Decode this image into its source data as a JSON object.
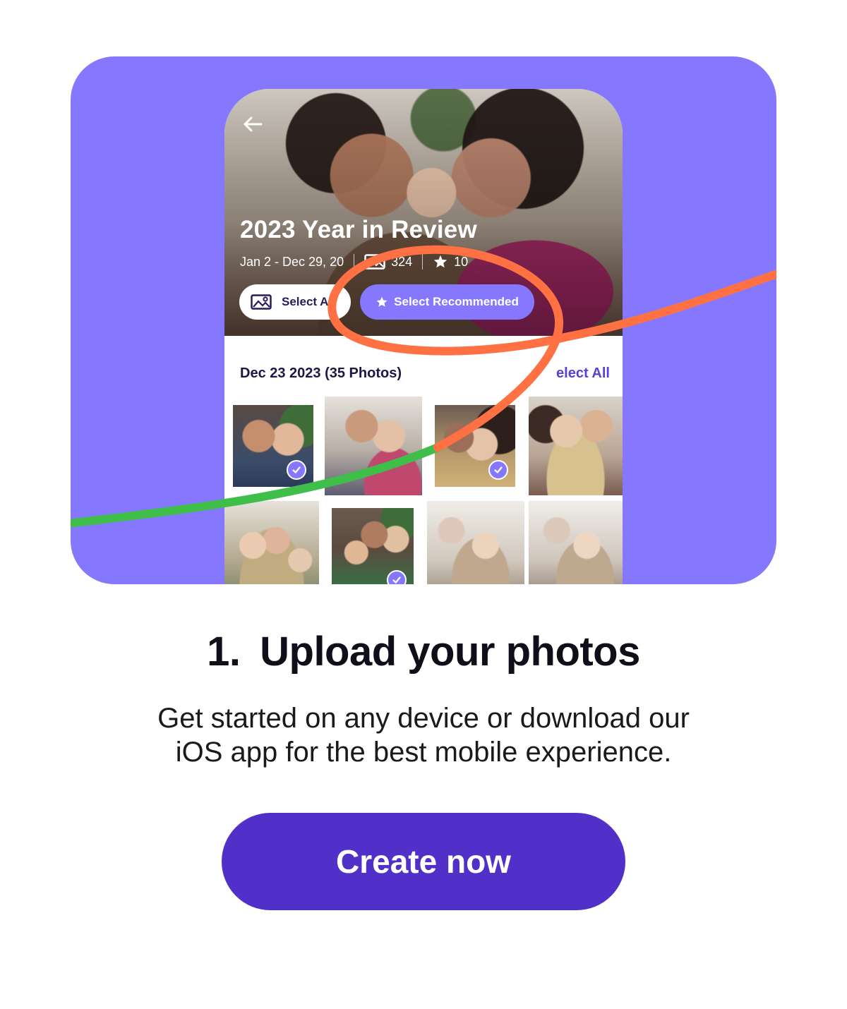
{
  "album": {
    "title": "2023 Year in Review",
    "date_range": "Jan 2 - Dec 29, 20",
    "photo_count": "324",
    "star_count": "10",
    "select_all_label": "Select A",
    "select_recommended_label": "Select Recommended"
  },
  "section": {
    "date_label": "Dec 23 2023 (35 Photos)",
    "select_all_label": "elect All"
  },
  "thumbnails": [
    {
      "selected": true
    },
    {
      "selected": false
    },
    {
      "selected": true
    },
    {
      "selected": false
    },
    {
      "selected": false
    },
    {
      "selected": true
    },
    {
      "selected": false
    },
    {
      "selected": false
    }
  ],
  "step": {
    "number": "1.",
    "title": "Upload your photos",
    "body_line1": "Get started on any device or download our",
    "body_line2": "iOS app for the best mobile experience."
  },
  "cta": {
    "label": "Create now"
  },
  "icons": {
    "back": "arrow-left-icon",
    "photos": "image-icon",
    "star": "star-icon",
    "check": "check-icon"
  },
  "colors": {
    "hero_background": "#8578ff",
    "cta_background": "#5030c8",
    "accent_purple": "#8578ff",
    "swoosh_orange": "#ff7043",
    "swoosh_green": "#3fbf4a"
  }
}
